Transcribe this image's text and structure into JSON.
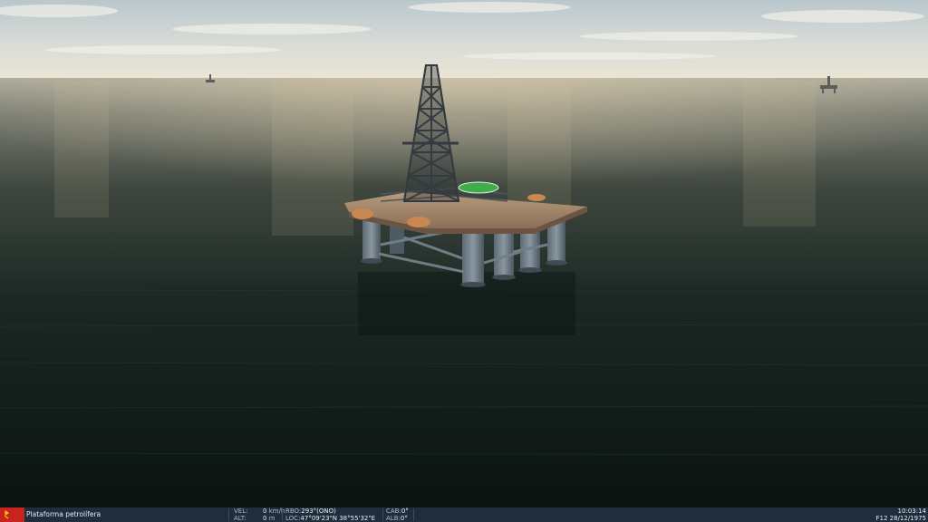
{
  "scene": {
    "description_icons": [
      "oil-platform",
      "helipad",
      "distant-rig"
    ],
    "colors": {
      "sky_top": "#c9d3d6",
      "sky_horizon": "#e6e3d6",
      "sea_far": "#8d8f86",
      "sea_near": "#0b1512",
      "helipad": "#3fae4a"
    }
  },
  "status_bar": {
    "flag_icon": "red-flag-icon",
    "selection_title": "Plataforma petrolífera",
    "vel_label": "VEL:",
    "vel_value": "0",
    "vel_unit": "km/h",
    "alt_label": "ALT:",
    "alt_value": "0",
    "alt_unit": "m",
    "rbo_label": "RBO:",
    "rbo_value": "293°(ONO)",
    "loc_label": "LOC:",
    "loc_value": "47°09'23\"N 38°55'32\"E",
    "cab_label": "CAB:",
    "cab_value": "0°",
    "alb_label": "ALB:",
    "alb_value": "0°",
    "time": "10:03:14",
    "date": "F12 28/12/1975"
  }
}
